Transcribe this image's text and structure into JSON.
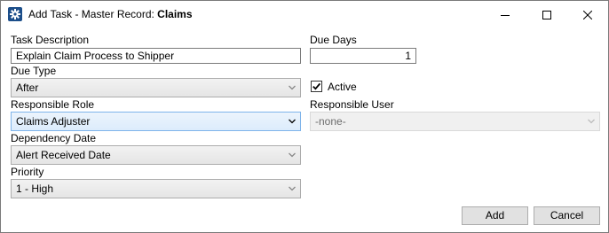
{
  "window": {
    "title_prefix": "Add Task - Master Record: ",
    "title_record": "Claims"
  },
  "form": {
    "task_description": {
      "label": "Task Description",
      "value": "Explain Claim Process to Shipper"
    },
    "due_days": {
      "label": "Due Days",
      "value": "1"
    },
    "due_type": {
      "label": "Due Type",
      "value": "After"
    },
    "active": {
      "label": "Active",
      "checked": true
    },
    "responsible_role": {
      "label": "Responsible Role",
      "value": "Claims Adjuster"
    },
    "responsible_user": {
      "label": "Responsible User",
      "value": "-none-"
    },
    "dependency_date": {
      "label": "Dependency Date",
      "value": "Alert Received Date"
    },
    "priority": {
      "label": "Priority",
      "value": "1 - High"
    }
  },
  "buttons": {
    "add": "Add",
    "cancel": "Cancel"
  },
  "icons": {
    "app": "gear-icon",
    "minimize": "minimize-icon",
    "maximize": "maximize-icon",
    "close": "close-icon",
    "dropdown": "chevron-down-icon",
    "check": "checkmark-icon"
  },
  "colors": {
    "focus_border": "#7eb4ea",
    "focus_fill": "#dcecfc",
    "app_icon": "#1c4e8a"
  }
}
